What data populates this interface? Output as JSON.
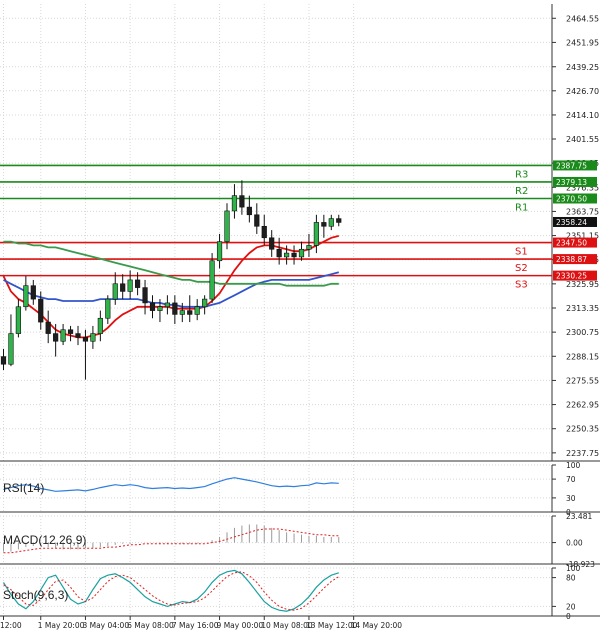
{
  "chart_data": {
    "type": "candlestick",
    "price_axis": {
      "ticks": [
        "2464.55",
        "2451.95",
        "2439.25",
        "2426.70",
        "2414.10",
        "2401.55",
        "2388.95",
        "2376.35",
        "2363.75",
        "2351.15",
        "2338.55",
        "2325.95",
        "2313.35",
        "2300.75",
        "2288.15",
        "2275.55",
        "2262.95",
        "2250.35",
        "2237.75"
      ],
      "tick_values": [
        2464.55,
        2451.95,
        2439.25,
        2426.7,
        2414.1,
        2401.55,
        2388.95,
        2376.35,
        2363.75,
        2351.15,
        2338.55,
        2325.95,
        2313.35,
        2300.75,
        2288.15,
        2275.55,
        2262.95,
        2250.35,
        2237.75
      ],
      "ylim": [
        2233.5,
        2472.0
      ]
    },
    "time_axis": {
      "labels": [
        "12:00",
        "1 May 20:00",
        "3 May 04:00",
        "6 May 08:00",
        "7 May 16:00",
        "9 May 00:00",
        "10 May 08:00",
        "13 May 12:00",
        "14 May 20:00"
      ],
      "label_bars": [
        0,
        5,
        11,
        17,
        23,
        29,
        35,
        41,
        47
      ]
    },
    "levels": [
      {
        "name": "R3",
        "value": 2387.75,
        "color": "#1a8a1a"
      },
      {
        "name": "R2",
        "value": 2379.13,
        "color": "#1a8a1a"
      },
      {
        "name": "R1",
        "value": 2370.5,
        "color": "#1a8a1a"
      },
      {
        "name": "S1",
        "value": 2347.5,
        "color": "#dd1111"
      },
      {
        "name": "S2",
        "value": 2338.87,
        "color": "#dd1111"
      },
      {
        "name": "S3",
        "value": 2330.25,
        "color": "#dd1111"
      }
    ],
    "level_labels": [
      "2387.75",
      "2379.13",
      "2370.50",
      "2347.50",
      "2338.87",
      "2330.25"
    ],
    "last_price": "2358.24",
    "last_price_value": 2358.24,
    "ohlc": [
      [
        2288,
        2292,
        2281,
        2284
      ],
      [
        2284,
        2310,
        2283,
        2300
      ],
      [
        2300,
        2318,
        2298,
        2314
      ],
      [
        2314,
        2330,
        2312,
        2325
      ],
      [
        2325,
        2328,
        2315,
        2318
      ],
      [
        2318,
        2322,
        2302,
        2306
      ],
      [
        2306,
        2312,
        2295,
        2300
      ],
      [
        2300,
        2305,
        2288,
        2296
      ],
      [
        2296,
        2305,
        2294,
        2302
      ],
      [
        2302,
        2304,
        2296,
        2300
      ],
      [
        2300,
        2304,
        2294,
        2298
      ],
      [
        2298,
        2302,
        2276,
        2296
      ],
      [
        2296,
        2304,
        2292,
        2300
      ],
      [
        2300,
        2312,
        2296,
        2308
      ],
      [
        2308,
        2320,
        2305,
        2318
      ],
      [
        2318,
        2332,
        2315,
        2326
      ],
      [
        2326,
        2331,
        2318,
        2322
      ],
      [
        2322,
        2333,
        2318,
        2328
      ],
      [
        2328,
        2332,
        2320,
        2324
      ],
      [
        2324,
        2328,
        2310,
        2316
      ],
      [
        2316,
        2320,
        2308,
        2312
      ],
      [
        2312,
        2318,
        2306,
        2314
      ],
      [
        2314,
        2320,
        2310,
        2316
      ],
      [
        2316,
        2320,
        2305,
        2310
      ],
      [
        2310,
        2316,
        2306,
        2312
      ],
      [
        2312,
        2320,
        2306,
        2310
      ],
      [
        2310,
        2318,
        2307,
        2314
      ],
      [
        2314,
        2320,
        2310,
        2318
      ],
      [
        2318,
        2342,
        2316,
        2338
      ],
      [
        2338,
        2352,
        2334,
        2348
      ],
      [
        2348,
        2368,
        2344,
        2364
      ],
      [
        2364,
        2378,
        2360,
        2372
      ],
      [
        2372,
        2380,
        2362,
        2366
      ],
      [
        2366,
        2372,
        2358,
        2362
      ],
      [
        2362,
        2368,
        2352,
        2356
      ],
      [
        2356,
        2362,
        2346,
        2350
      ],
      [
        2350,
        2354,
        2340,
        2344
      ],
      [
        2344,
        2350,
        2336,
        2340
      ],
      [
        2340,
        2346,
        2336,
        2342
      ],
      [
        2342,
        2346,
        2336,
        2340
      ],
      [
        2340,
        2348,
        2338,
        2344
      ],
      [
        2344,
        2352,
        2340,
        2346
      ],
      [
        2346,
        2362,
        2342,
        2358
      ],
      [
        2358,
        2362,
        2350,
        2356
      ],
      [
        2356,
        2362,
        2354,
        2360
      ],
      [
        2360,
        2362,
        2356,
        2358
      ]
    ],
    "moving_averages": [
      {
        "name": "MA fast",
        "color": "#e01010",
        "values": [
          2330,
          2322,
          2318,
          2316,
          2313,
          2310,
          2306,
          2302,
          2300,
          2299,
          2298,
          2298,
          2299,
          2300,
          2303,
          2307,
          2310,
          2312,
          2314,
          2314,
          2314,
          2314,
          2314,
          2313,
          2313,
          2313,
          2313,
          2314,
          2317,
          2321,
          2327,
          2333,
          2338,
          2342,
          2345,
          2346,
          2346,
          2345,
          2344,
          2343,
          2343,
          2344,
          2346,
          2348,
          2350,
          2351
        ]
      },
      {
        "name": "MA medium",
        "color": "#3355cc",
        "values": [
          2328,
          2326,
          2324,
          2322,
          2320,
          2319,
          2318,
          2318,
          2317,
          2317,
          2317,
          2317,
          2317,
          2318,
          2318,
          2318,
          2318,
          2318,
          2318,
          2317,
          2316,
          2316,
          2315,
          2315,
          2314,
          2314,
          2314,
          2314,
          2315,
          2316,
          2318,
          2320,
          2322,
          2324,
          2326,
          2327,
          2328,
          2328,
          2328,
          2328,
          2328,
          2328,
          2329,
          2330,
          2331,
          2332
        ]
      },
      {
        "name": "MA slow",
        "color": "#3a9a4a",
        "values": [
          2348,
          2348,
          2347,
          2347,
          2346,
          2346,
          2345,
          2345,
          2344,
          2343,
          2342,
          2341,
          2340,
          2339,
          2338,
          2337,
          2336,
          2335,
          2334,
          2333,
          2332,
          2331,
          2330,
          2329,
          2328,
          2328,
          2327,
          2327,
          2327,
          2326,
          2326,
          2326,
          2326,
          2326,
          2326,
          2326,
          2326,
          2326,
          2325,
          2325,
          2325,
          2325,
          2325,
          2325,
          2326,
          2326
        ]
      }
    ],
    "indicators": [
      {
        "name": "RSI(14)",
        "ticks": [
          "100",
          "70",
          "30",
          "0"
        ],
        "ylim": [
          0,
          100
        ],
        "tick_values": [
          100,
          70,
          30,
          0
        ],
        "values": [
          48,
          52,
          56,
          58,
          55,
          50,
          47,
          44,
          45,
          46,
          47,
          45,
          48,
          52,
          55,
          58,
          56,
          58,
          56,
          52,
          50,
          51,
          52,
          50,
          51,
          50,
          52,
          54,
          60,
          65,
          70,
          73,
          70,
          67,
          64,
          60,
          56,
          54,
          55,
          54,
          56,
          57,
          62,
          60,
          62,
          61
        ]
      },
      {
        "name": "MACD(12,26,9)",
        "ticks": [
          "23.481",
          "0.00",
          "-18.923"
        ],
        "ylim": [
          -18.923,
          23.481
        ],
        "tick_values": [
          23.481,
          0,
          -18.923
        ],
        "values": [
          -8,
          -8,
          -6,
          -4,
          -3,
          -3,
          -4,
          -5,
          -6,
          -6,
          -6,
          -5,
          -5,
          -4,
          -3,
          -2,
          -1,
          -1,
          0,
          0,
          0,
          -1,
          -1,
          -1,
          -1,
          -1,
          -1,
          0,
          2,
          5,
          9,
          13,
          15,
          16,
          16,
          15,
          13,
          11,
          9,
          8,
          7,
          6,
          6,
          5,
          5,
          5
        ],
        "signal": [
          -9,
          -9,
          -8,
          -7,
          -6,
          -5,
          -5,
          -5,
          -5,
          -5,
          -5,
          -5,
          -5,
          -5,
          -4,
          -4,
          -3,
          -2,
          -2,
          -1,
          -1,
          -1,
          -1,
          -1,
          -1,
          -1,
          -1,
          -1,
          0,
          1,
          3,
          5,
          7,
          9,
          11,
          12,
          12,
          12,
          11,
          10,
          9,
          8,
          7,
          7,
          6,
          6
        ]
      },
      {
        "name": "Stoch(9,6,3)",
        "ticks": [
          "100",
          "80",
          "20",
          "0"
        ],
        "ylim": [
          0,
          100
        ],
        "tick_values": [
          100,
          80,
          20,
          0
        ],
        "k": [
          70,
          45,
          25,
          15,
          30,
          55,
          80,
          85,
          60,
          35,
          25,
          30,
          55,
          78,
          85,
          88,
          80,
          70,
          55,
          40,
          30,
          25,
          20,
          25,
          30,
          28,
          35,
          50,
          70,
          85,
          92,
          95,
          88,
          70,
          50,
          30,
          18,
          12,
          10,
          15,
          25,
          40,
          60,
          75,
          85,
          90
        ],
        "d": [
          65,
          55,
          40,
          25,
          22,
          35,
          55,
          72,
          75,
          60,
          40,
          30,
          38,
          55,
          72,
          82,
          85,
          80,
          68,
          55,
          42,
          32,
          25,
          23,
          26,
          28,
          30,
          38,
          52,
          68,
          82,
          90,
          92,
          84,
          70,
          50,
          33,
          20,
          14,
          12,
          16,
          27,
          42,
          58,
          72,
          82
        ]
      }
    ]
  }
}
